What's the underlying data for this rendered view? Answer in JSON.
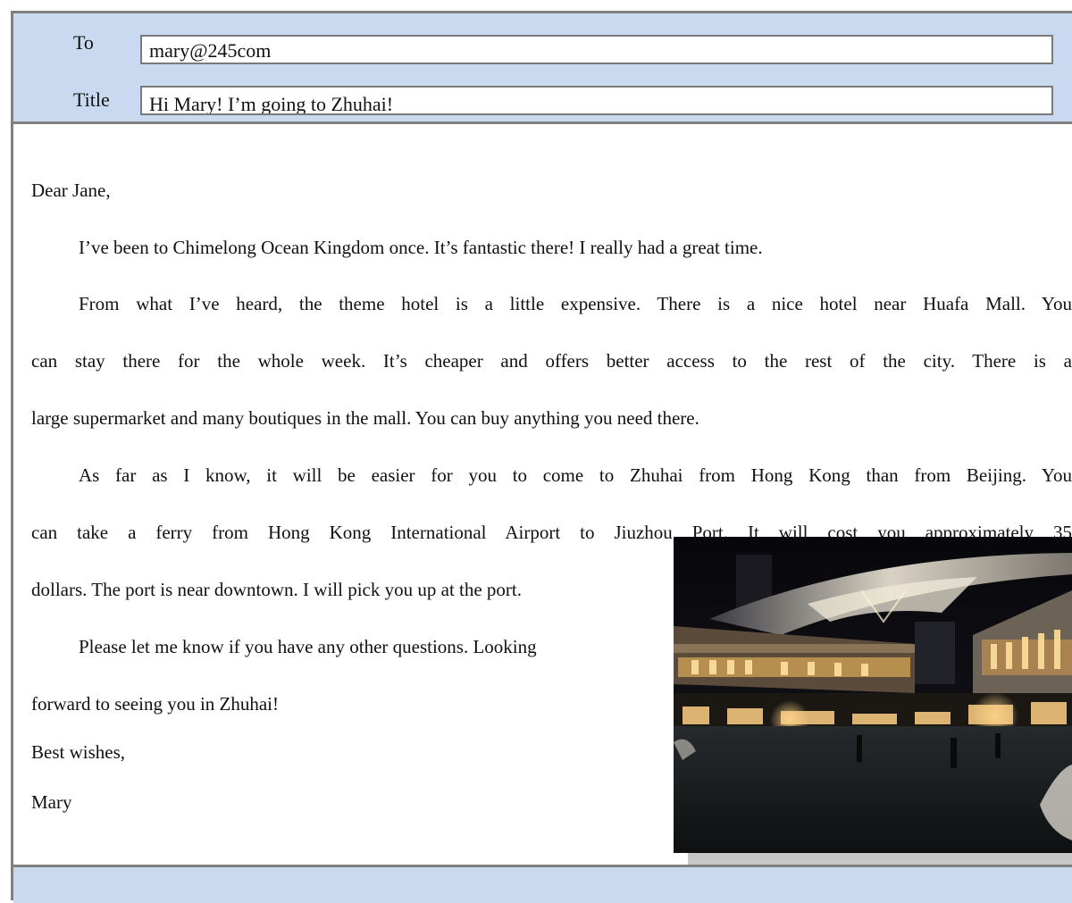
{
  "header": {
    "to_label": "To",
    "to_value": "mary@245com",
    "title_label": "Title",
    "title_value": "Hi Mary! I’m going to Zhuhai!"
  },
  "letter": {
    "greeting": "Dear Jane,",
    "p1": "I’ve been to Chimelong Ocean Kingdom once. It’s fantastic there! I really had a great time.",
    "p2_l1": "From what I’ve heard, the theme hotel is a little expensive. There is a nice hotel near Huafa Mall. You",
    "p2_l2": "can stay there for the whole week. It’s cheaper and offers better access to the rest of the city. There is a",
    "p2_l3": "large supermarket and many boutiques in the mall. You can buy anything you need there.",
    "p3_l1": "As far as I know, it will be easier for you to come to Zhuhai from Hong Kong than from Beijing. You",
    "p3_l2": "can take a ferry from Hong Kong International Airport to Jiuzhou Port. It will cost you approximately 35",
    "p3_l3": "dollars. The port is near downtown. I will pick you up at the port.",
    "p4_l1": "Please let me know if you have any other questions. Looking",
    "p4_l2": "forward to seeing you in Zhuhai!",
    "closing": "Best wishes,",
    "signature": "Mary"
  },
  "colors": {
    "header_bg": "#c9daf0",
    "border": "#808080"
  }
}
